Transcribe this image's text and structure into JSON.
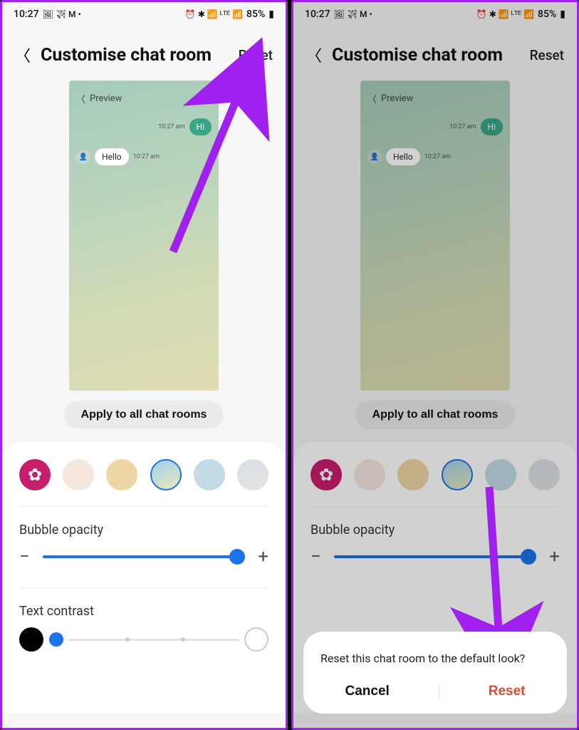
{
  "status": {
    "time": "10:27",
    "battery": "85%"
  },
  "header": {
    "title": "Customise chat room",
    "reset": "Reset"
  },
  "preview": {
    "label": "Preview",
    "msg_hi": "Hi",
    "msg_hello": "Hello",
    "ts1": "10:27 am",
    "ts2": "10:27 am"
  },
  "apply_label": "Apply to all chat rooms",
  "sections": {
    "opacity": "Bubble opacity",
    "contrast": "Text contrast"
  },
  "dialog": {
    "message": "Reset this chat room to the default look?",
    "cancel": "Cancel",
    "reset": "Reset"
  }
}
